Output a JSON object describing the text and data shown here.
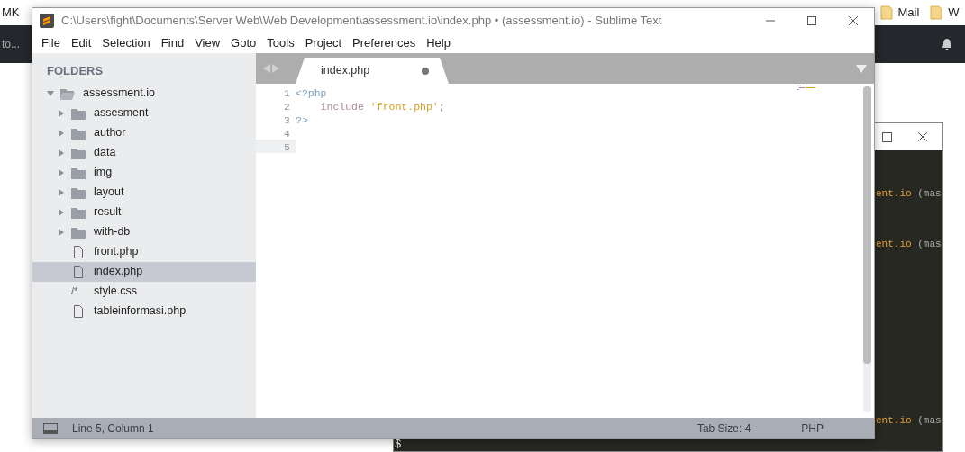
{
  "browser": {
    "bookmarks": [
      {
        "label": "MK",
        "folder": false
      },
      {
        "label": "Mail",
        "folder": true
      },
      {
        "label": "W",
        "folder": true
      }
    ],
    "nav_text": "to..."
  },
  "terminal": {
    "lines": [
      {
        "path": "ent.io",
        "rest": "(mas"
      },
      {
        "path": "ent.io",
        "rest": "(mas"
      },
      {
        "path": "ent.io",
        "rest": "(mas"
      }
    ],
    "prompt": "$"
  },
  "window": {
    "title": "C:\\Users\\fight\\Documents\\Server Web\\Web Development\\assessment.io\\index.php • (assessment.io) - Sublime Text"
  },
  "menu": [
    "File",
    "Edit",
    "Selection",
    "Find",
    "View",
    "Goto",
    "Tools",
    "Project",
    "Preferences",
    "Help"
  ],
  "sidebar": {
    "heading": "FOLDERS",
    "items": [
      {
        "label": "assessment.io",
        "kind": "folder",
        "expanded": true,
        "selected": false,
        "children": [
          {
            "label": "assesment",
            "kind": "folder",
            "expanded": false,
            "selected": false
          },
          {
            "label": "author",
            "kind": "folder",
            "expanded": false,
            "selected": false
          },
          {
            "label": "data",
            "kind": "folder",
            "expanded": false,
            "selected": false
          },
          {
            "label": "img",
            "kind": "folder",
            "expanded": false,
            "selected": false
          },
          {
            "label": "layout",
            "kind": "folder",
            "expanded": false,
            "selected": false
          },
          {
            "label": "result",
            "kind": "folder",
            "expanded": false,
            "selected": false
          },
          {
            "label": "with-db",
            "kind": "folder",
            "expanded": false,
            "selected": false
          },
          {
            "label": "front.php",
            "kind": "file",
            "selected": false
          },
          {
            "label": "index.php",
            "kind": "file",
            "selected": true
          },
          {
            "label": "style.css",
            "kind": "css",
            "glyph": "/*",
            "selected": false
          },
          {
            "label": "tableinformasi.php",
            "kind": "file",
            "selected": false
          }
        ]
      }
    ]
  },
  "tabs": [
    {
      "label": "index.php",
      "selected": true,
      "modified": true
    }
  ],
  "code": {
    "lines": [
      {
        "number": "1",
        "current": false,
        "tokens": [
          {
            "text": "<?php",
            "kind": "tag"
          }
        ]
      },
      {
        "number": "2",
        "current": false,
        "tokens": [
          {
            "text": "    include",
            "kind": "keyword"
          },
          {
            "text": " 'front.php'",
            "kind": "string"
          },
          {
            "text": ";",
            "kind": "punct"
          }
        ]
      },
      {
        "number": "3",
        "current": false,
        "tokens": [
          {
            "text": "?>",
            "kind": "tag"
          }
        ]
      },
      {
        "number": "4",
        "current": false
      },
      {
        "number": "5",
        "current": true
      }
    ]
  },
  "status_bar": {
    "position": "Line 5, Column 1",
    "tab_size": "Tab Size: 4",
    "syntax": "PHP"
  }
}
